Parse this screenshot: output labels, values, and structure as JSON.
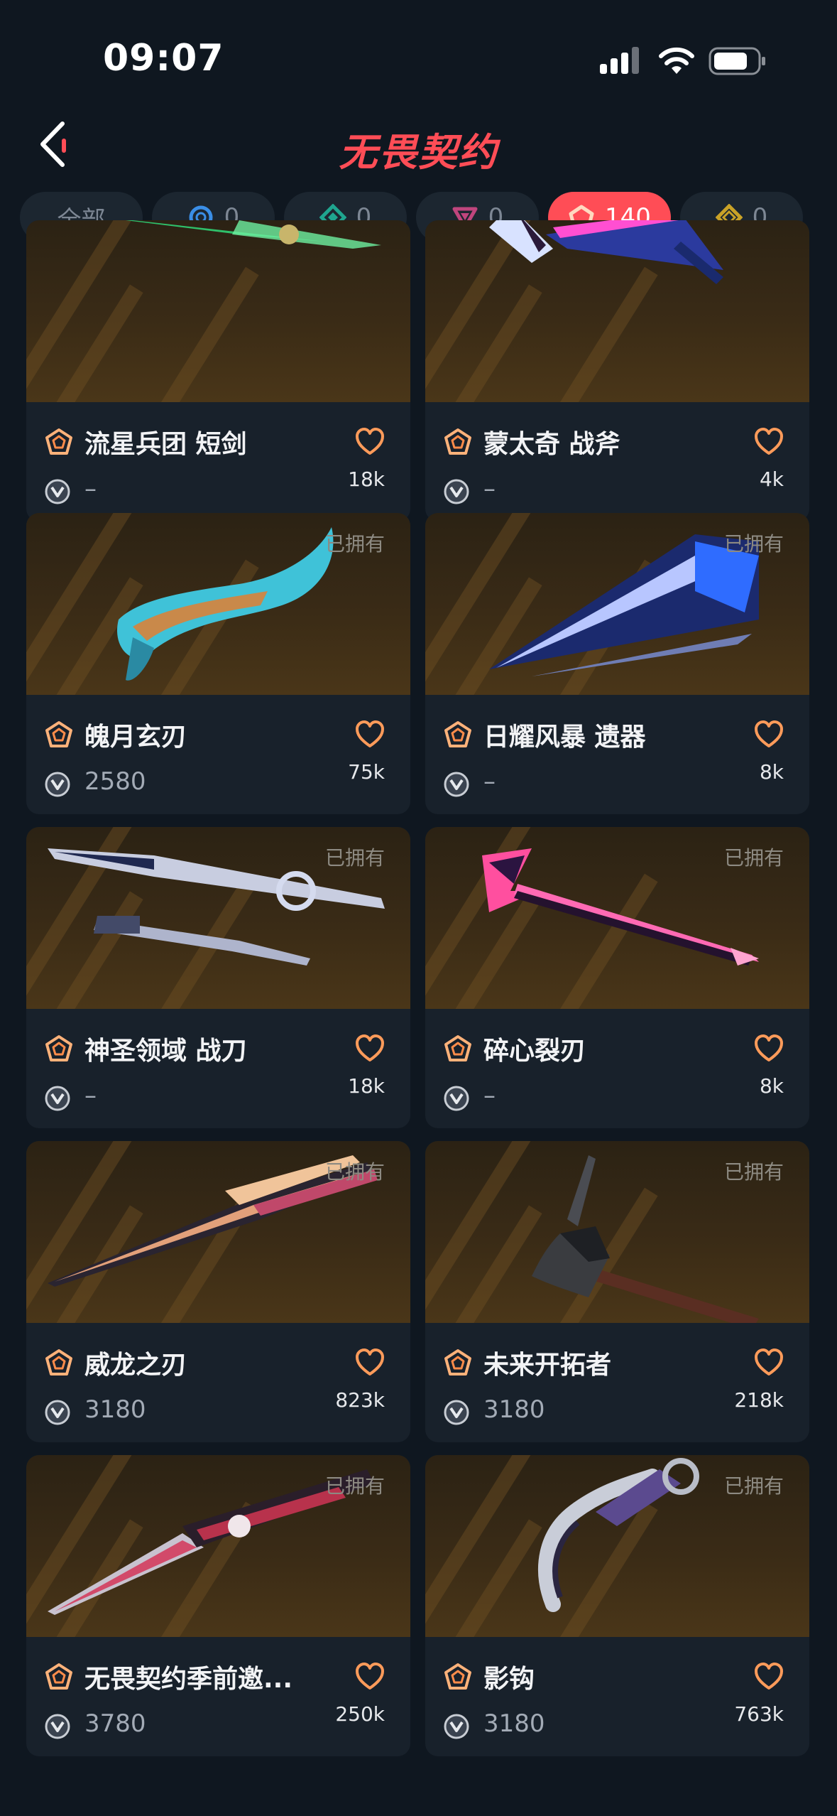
{
  "status_bar": {
    "time": "09:07"
  },
  "header": {
    "title": "无畏契约"
  },
  "tabs": [
    {
      "label": "全部",
      "icon": "all",
      "active": false
    },
    {
      "label": "0",
      "icon": "tier-select-icon",
      "color": "#3a8ee6",
      "active": false
    },
    {
      "label": "0",
      "icon": "tier-deluxe-icon",
      "color": "#1fa58f",
      "active": false
    },
    {
      "label": "0",
      "icon": "tier-premium-icon",
      "color": "#c0457d",
      "active": false
    },
    {
      "label": "140",
      "icon": "tier-exclusive-icon",
      "color": "#ffb27a",
      "active": true
    },
    {
      "label": "0",
      "icon": "tier-ultra-icon",
      "color": "#c9a227",
      "active": false
    }
  ],
  "items": [
    {
      "name": "流星兵团 短剑",
      "price": "–",
      "likes": "18k",
      "owned": "",
      "weapon": "green-dagger"
    },
    {
      "name": "蒙太奇 战斧",
      "price": "–",
      "likes": "4k",
      "owned": "",
      "weapon": "neon-axe"
    },
    {
      "name": "魄月玄刃",
      "price": "2580",
      "likes": "75k",
      "owned": "已拥有",
      "weapon": "teal-curved-blade"
    },
    {
      "name": "日耀风暴 遗器",
      "price": "–",
      "likes": "8k",
      "owned": "已拥有",
      "weapon": "blue-crystal-blade"
    },
    {
      "name": "神圣领域 战刀",
      "price": "–",
      "likes": "18k",
      "owned": "已拥有",
      "weapon": "twin-silver-blades"
    },
    {
      "name": "碎心裂刃",
      "price": "–",
      "likes": "8k",
      "owned": "已拥有",
      "weapon": "pink-spear"
    },
    {
      "name": "威龙之刃",
      "price": "3180",
      "likes": "823k",
      "owned": "已拥有",
      "weapon": "bronze-blade"
    },
    {
      "name": "未来开拓者",
      "price": "3180",
      "likes": "218k",
      "owned": "已拥有",
      "weapon": "hatchet"
    },
    {
      "name": "无畏契约季前邀...",
      "price": "3780",
      "likes": "250k",
      "owned": "已拥有",
      "weapon": "red-butterfly-knife"
    },
    {
      "name": "影钩",
      "price": "3180",
      "likes": "763k",
      "owned": "已拥有",
      "weapon": "karambit"
    }
  ],
  "colors": {
    "accent": "#ff4d56",
    "tier_exclusive": "#ffb27a",
    "heart": "#ff9b5a"
  }
}
